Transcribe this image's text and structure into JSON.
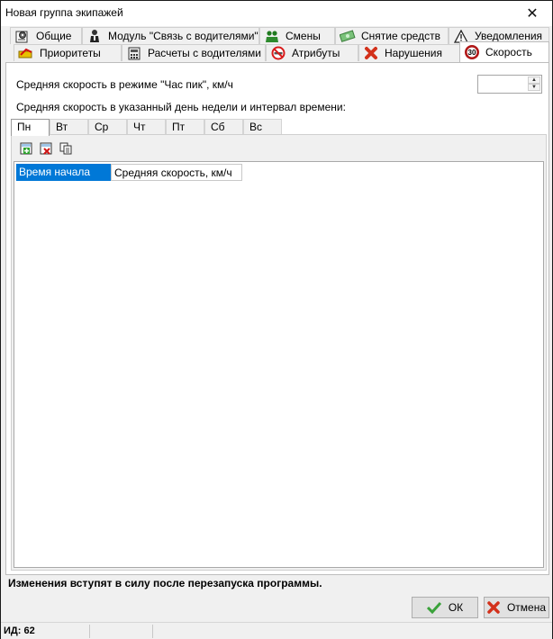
{
  "window": {
    "title": "Новая группа экипажей"
  },
  "tabs_row1": [
    {
      "label": "Общие",
      "icon": "settings-doc-icon"
    },
    {
      "label": "Модуль \"Связь с водителями\"",
      "icon": "person-icon"
    },
    {
      "label": "Смены",
      "icon": "people-icon"
    },
    {
      "label": "Снятие средств",
      "icon": "money-icon"
    },
    {
      "label": "Уведомления",
      "icon": "warning-icon"
    }
  ],
  "tabs_row2": [
    {
      "label": "Приоритеты",
      "icon": "priority-icon"
    },
    {
      "label": "Расчеты с водителями",
      "icon": "calculator-icon"
    },
    {
      "label": "Атрибуты",
      "icon": "no-smoking-icon"
    },
    {
      "label": "Нарушения",
      "icon": "red-x-icon"
    },
    {
      "label": "Скорость",
      "icon": "speed-limit-icon",
      "badge": "30",
      "active": true
    }
  ],
  "speed": {
    "rush_label": "Средняя скорость в режиме \"Час пик\", км/ч",
    "rush_value": "",
    "weekday_label": "Средняя скорость в указанный день недели и интервал времени:"
  },
  "days": [
    "Пн",
    "Вт",
    "Ср",
    "Чт",
    "Пт",
    "Сб",
    "Вс"
  ],
  "active_day": "Пн",
  "grid": {
    "columns": [
      "Время начала",
      "Средняя скорость, км/ч"
    ]
  },
  "notice": "Изменения вступят в силу после перезапуска программы.",
  "buttons": {
    "ok": "ОК",
    "cancel": "Отмена"
  },
  "status": {
    "id": "ИД: 62"
  }
}
